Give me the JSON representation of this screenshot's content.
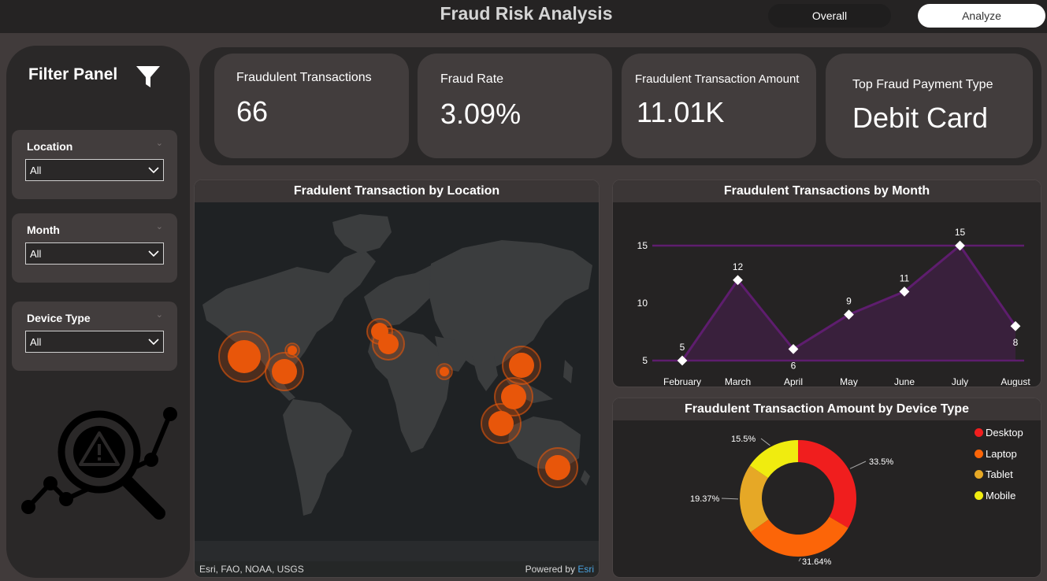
{
  "header": {
    "title": "Fraud Risk Analysis",
    "tabs": [
      {
        "label": "Overall",
        "active": false
      },
      {
        "label": "Analyze",
        "active": true
      }
    ]
  },
  "filter_panel": {
    "title": "Filter Panel",
    "slicers": [
      {
        "label": "Location",
        "value": "All"
      },
      {
        "label": "Month",
        "value": "All"
      },
      {
        "label": "Device Type",
        "value": "All"
      }
    ]
  },
  "kpis": [
    {
      "label": "Fraudulent Transactions",
      "value": "66"
    },
    {
      "label": "Fraud Rate",
      "value": "3.09%"
    },
    {
      "label": "Fraudulent Transaction Amount",
      "value": "11.01K"
    },
    {
      "label": "Top Fraud Payment Type",
      "value": "Debit Card"
    }
  ],
  "map": {
    "title": "Fradulent Transaction by Location",
    "attribution": "Esri, FAO, NOAA, USGS",
    "powered_by": "Powered by",
    "powered_brand": "Esri"
  },
  "line_chart": {
    "title": "Fraudulent Transactions by Month"
  },
  "donut_chart": {
    "title": "Fraudulent Transaction Amount by Device Type"
  },
  "colors": {
    "accent_purple": "#5e1d6e",
    "marker_orange": "#e8560a",
    "desktop": "#f01e1e",
    "laptop": "#fc6508",
    "tablet": "#e6a826",
    "mobile": "#f0ec0f"
  },
  "chart_data": [
    {
      "type": "line",
      "title": "Fraudulent Transactions by Month",
      "categories": [
        "February",
        "March",
        "April",
        "May",
        "June",
        "July",
        "August"
      ],
      "values": [
        5,
        12,
        6,
        9,
        11,
        15,
        8
      ],
      "yticks": [
        5,
        10,
        15
      ],
      "ylim": [
        5,
        15
      ],
      "data_labels": true
    },
    {
      "type": "pie",
      "title": "Fraudulent Transaction Amount by Device Type",
      "categories": [
        "Desktop",
        "Laptop",
        "Tablet",
        "Mobile"
      ],
      "values": [
        33.5,
        31.64,
        19.37,
        15.5
      ],
      "labels": [
        "33.5%",
        "31.64%",
        "19.37%",
        "15.5%"
      ],
      "legend": "right"
    }
  ]
}
